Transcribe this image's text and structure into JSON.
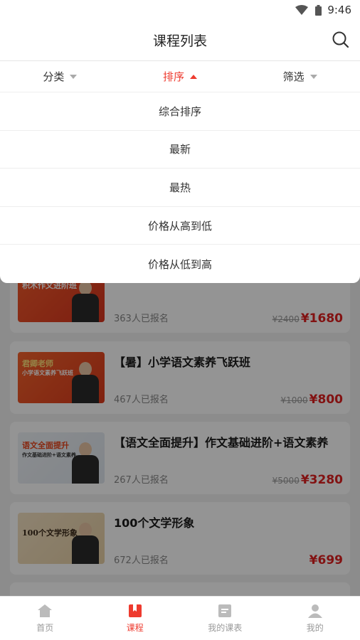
{
  "status": {
    "time": "9:46"
  },
  "header": {
    "title": "课程列表"
  },
  "filters": [
    {
      "label": "分类",
      "active": false
    },
    {
      "label": "排序",
      "active": true
    },
    {
      "label": "筛选",
      "active": false
    }
  ],
  "sort_options": [
    "综合排序",
    "最新",
    "最热",
    "价格从高到低",
    "价格从低到高"
  ],
  "courses": [
    {
      "title": "",
      "thumb_lines": [
        "积木作文进阶班"
      ],
      "enrolled": "363人已报名",
      "old_price": "¥2400",
      "price": "¥1680"
    },
    {
      "title": "【暑】小学语文素养飞跃班",
      "thumb_lines": [
        "君卿老师",
        "小学语文素养飞跃班"
      ],
      "enrolled": "467人已报名",
      "old_price": "¥1000",
      "price": "¥800"
    },
    {
      "title": "【语文全面提升】作文基础进阶+语文素养",
      "thumb_lines": [
        "语文全面提升",
        "作文基础进阶+语文素养"
      ],
      "enrolled": "267人已报名",
      "old_price": "¥5000",
      "price": "¥3280"
    },
    {
      "title": "100个文学形象",
      "thumb_lines": [
        "100个文学形象"
      ],
      "enrolled": "672人已报名",
      "old_price": "",
      "price": "¥699"
    }
  ],
  "tabs": [
    {
      "label": "首页",
      "icon": "home-icon",
      "active": false
    },
    {
      "label": "课程",
      "icon": "course-icon",
      "active": true
    },
    {
      "label": "我的课表",
      "icon": "schedule-icon",
      "active": false
    },
    {
      "label": "我的",
      "icon": "profile-icon",
      "active": false
    }
  ],
  "colors": {
    "accent": "#ee3b2f",
    "price": "#e02020"
  }
}
